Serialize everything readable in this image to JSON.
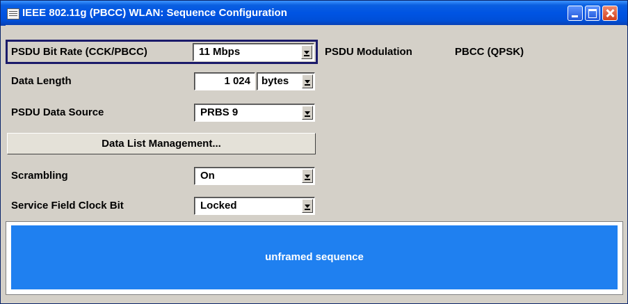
{
  "window": {
    "title": "IEEE 802.11g (PBCC) WLAN: Sequence Configuration"
  },
  "fields": {
    "psdu_bit_rate": {
      "label": "PSDU Bit Rate (CCK/PBCC)",
      "value": "11 Mbps"
    },
    "psdu_modulation": {
      "label": "PSDU Modulation",
      "value": "PBCC (QPSK)"
    },
    "data_length": {
      "label": "Data Length",
      "value": "1 024",
      "unit": "bytes"
    },
    "psdu_data_source": {
      "label": "PSDU Data Source",
      "value": "PRBS 9"
    },
    "data_list_button": {
      "label": "Data List Management..."
    },
    "scrambling": {
      "label": "Scrambling",
      "value": "On"
    },
    "service_field_clock_bit": {
      "label": "Service Field Clock Bit",
      "value": "Locked"
    }
  },
  "sequence": {
    "label": "unframed sequence",
    "color": "#1f80f0"
  },
  "icons": [
    "window-app-icon",
    "minimize-icon",
    "maximize-icon",
    "close-icon",
    "dropdown-arrow-icon"
  ]
}
